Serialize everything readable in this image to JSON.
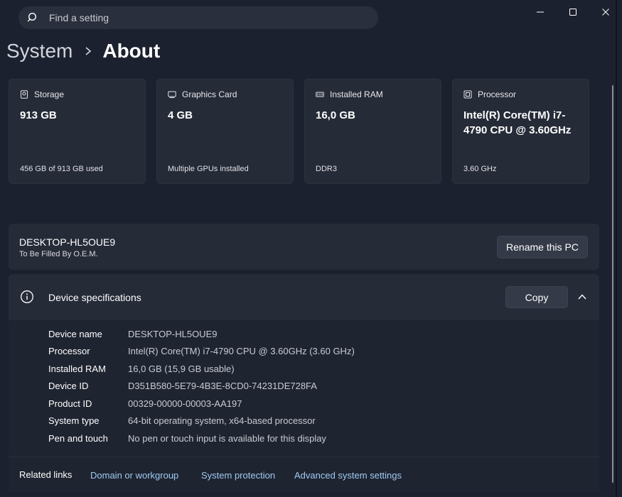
{
  "search": {
    "placeholder": "Find a setting"
  },
  "window_controls": [
    "minimize",
    "maximize",
    "close"
  ],
  "breadcrumb": {
    "parent": "System",
    "current": "About"
  },
  "cards": [
    {
      "title": "Storage",
      "icon": "storage-icon",
      "value": "913 GB",
      "sub": "456 GB of 913 GB used"
    },
    {
      "title": "Graphics Card",
      "icon": "graphics-card-icon",
      "value": "4 GB",
      "sub": "Multiple GPUs installed"
    },
    {
      "title": "Installed RAM",
      "icon": "ram-icon",
      "value": "16,0 GB",
      "sub": "DDR3"
    },
    {
      "title": "Processor",
      "icon": "processor-icon",
      "value": "Intel(R) Core(TM) i7-4790 CPU @ 3.60GHz",
      "sub": "3.60 GHz"
    }
  ],
  "pc": {
    "name": "DESKTOP-HL5OUE9",
    "model": "To Be Filled By O.E.M.",
    "rename_label": "Rename this PC"
  },
  "specs": {
    "title": "Device specifications",
    "copy_label": "Copy",
    "rows": [
      {
        "key": "Device name",
        "value": "DESKTOP-HL5OUE9"
      },
      {
        "key": "Processor",
        "value": "Intel(R) Core(TM) i7-4790 CPU @ 3.60GHz (3.60 GHz)"
      },
      {
        "key": "Installed RAM",
        "value": "16,0 GB (15,9 GB usable)"
      },
      {
        "key": "Device ID",
        "value": "D351B580-5E79-4B3E-8CD0-74231DE728FA"
      },
      {
        "key": "Product ID",
        "value": "00329-00000-00003-AA197"
      },
      {
        "key": "System type",
        "value": "64-bit operating system, x64-based processor"
      },
      {
        "key": "Pen and touch",
        "value": "No pen or touch input is available for this display"
      }
    ]
  },
  "related": {
    "label": "Related links",
    "links": [
      "Domain or workgroup",
      "System protection",
      "Advanced system settings"
    ]
  },
  "colors": {
    "background": "#1c2130",
    "card": "#262b38",
    "link": "#9ecbf2"
  }
}
